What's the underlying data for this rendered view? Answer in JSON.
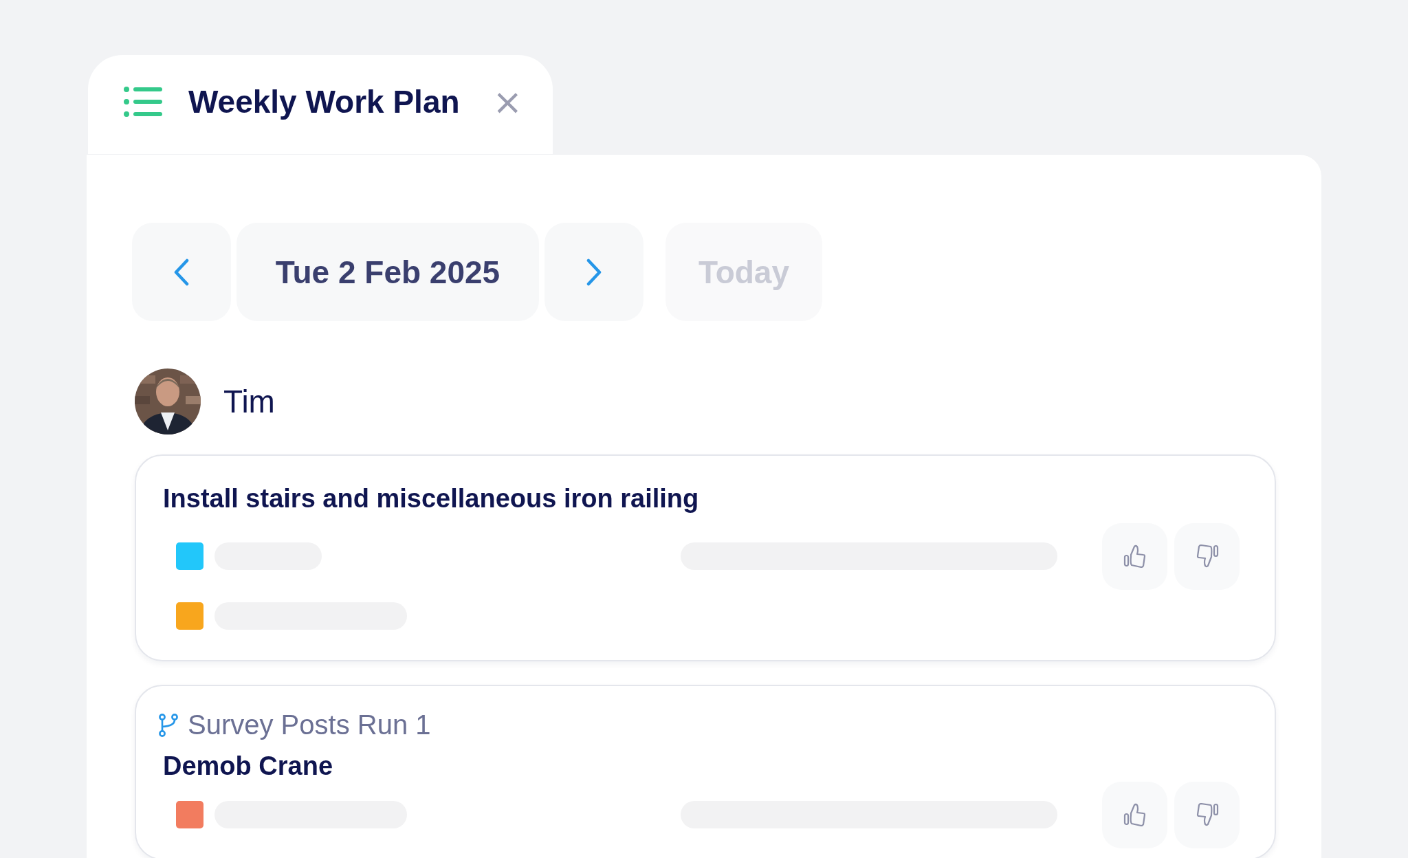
{
  "tab": {
    "title": "Weekly Work Plan",
    "close": "×"
  },
  "date_nav": {
    "date": "Tue 2 Feb 2025",
    "today": "Today",
    "today_disabled": true
  },
  "person": {
    "name": "Tim"
  },
  "tasks": [
    {
      "title": "Install stairs and miscellaneous iron railing",
      "rows": [
        {
          "color": "#22c7fa"
        },
        {
          "color": "#f8a61d"
        }
      ]
    },
    {
      "parent": "Survey Posts Run 1",
      "title": "Demob Crane",
      "rows": [
        {
          "color": "#f27c5f"
        }
      ]
    }
  ]
}
